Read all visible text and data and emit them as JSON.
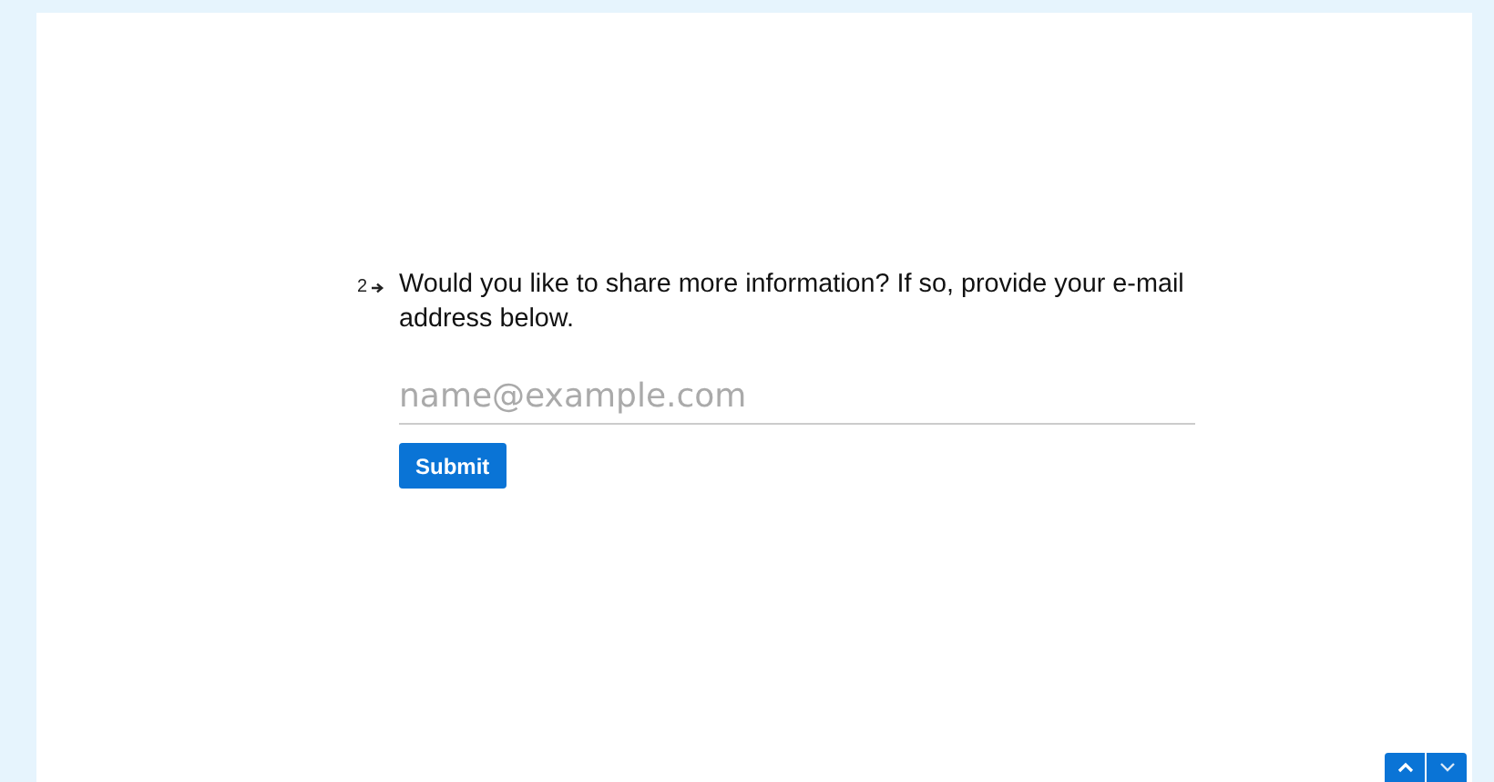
{
  "question": {
    "number": "2",
    "text": "Would you like to share more information? If so, provide your e-mail address below.",
    "placeholder": "name@example.com",
    "submit": "Submit"
  },
  "navigation": {
    "up_disabled": false,
    "down_disabled": false
  }
}
